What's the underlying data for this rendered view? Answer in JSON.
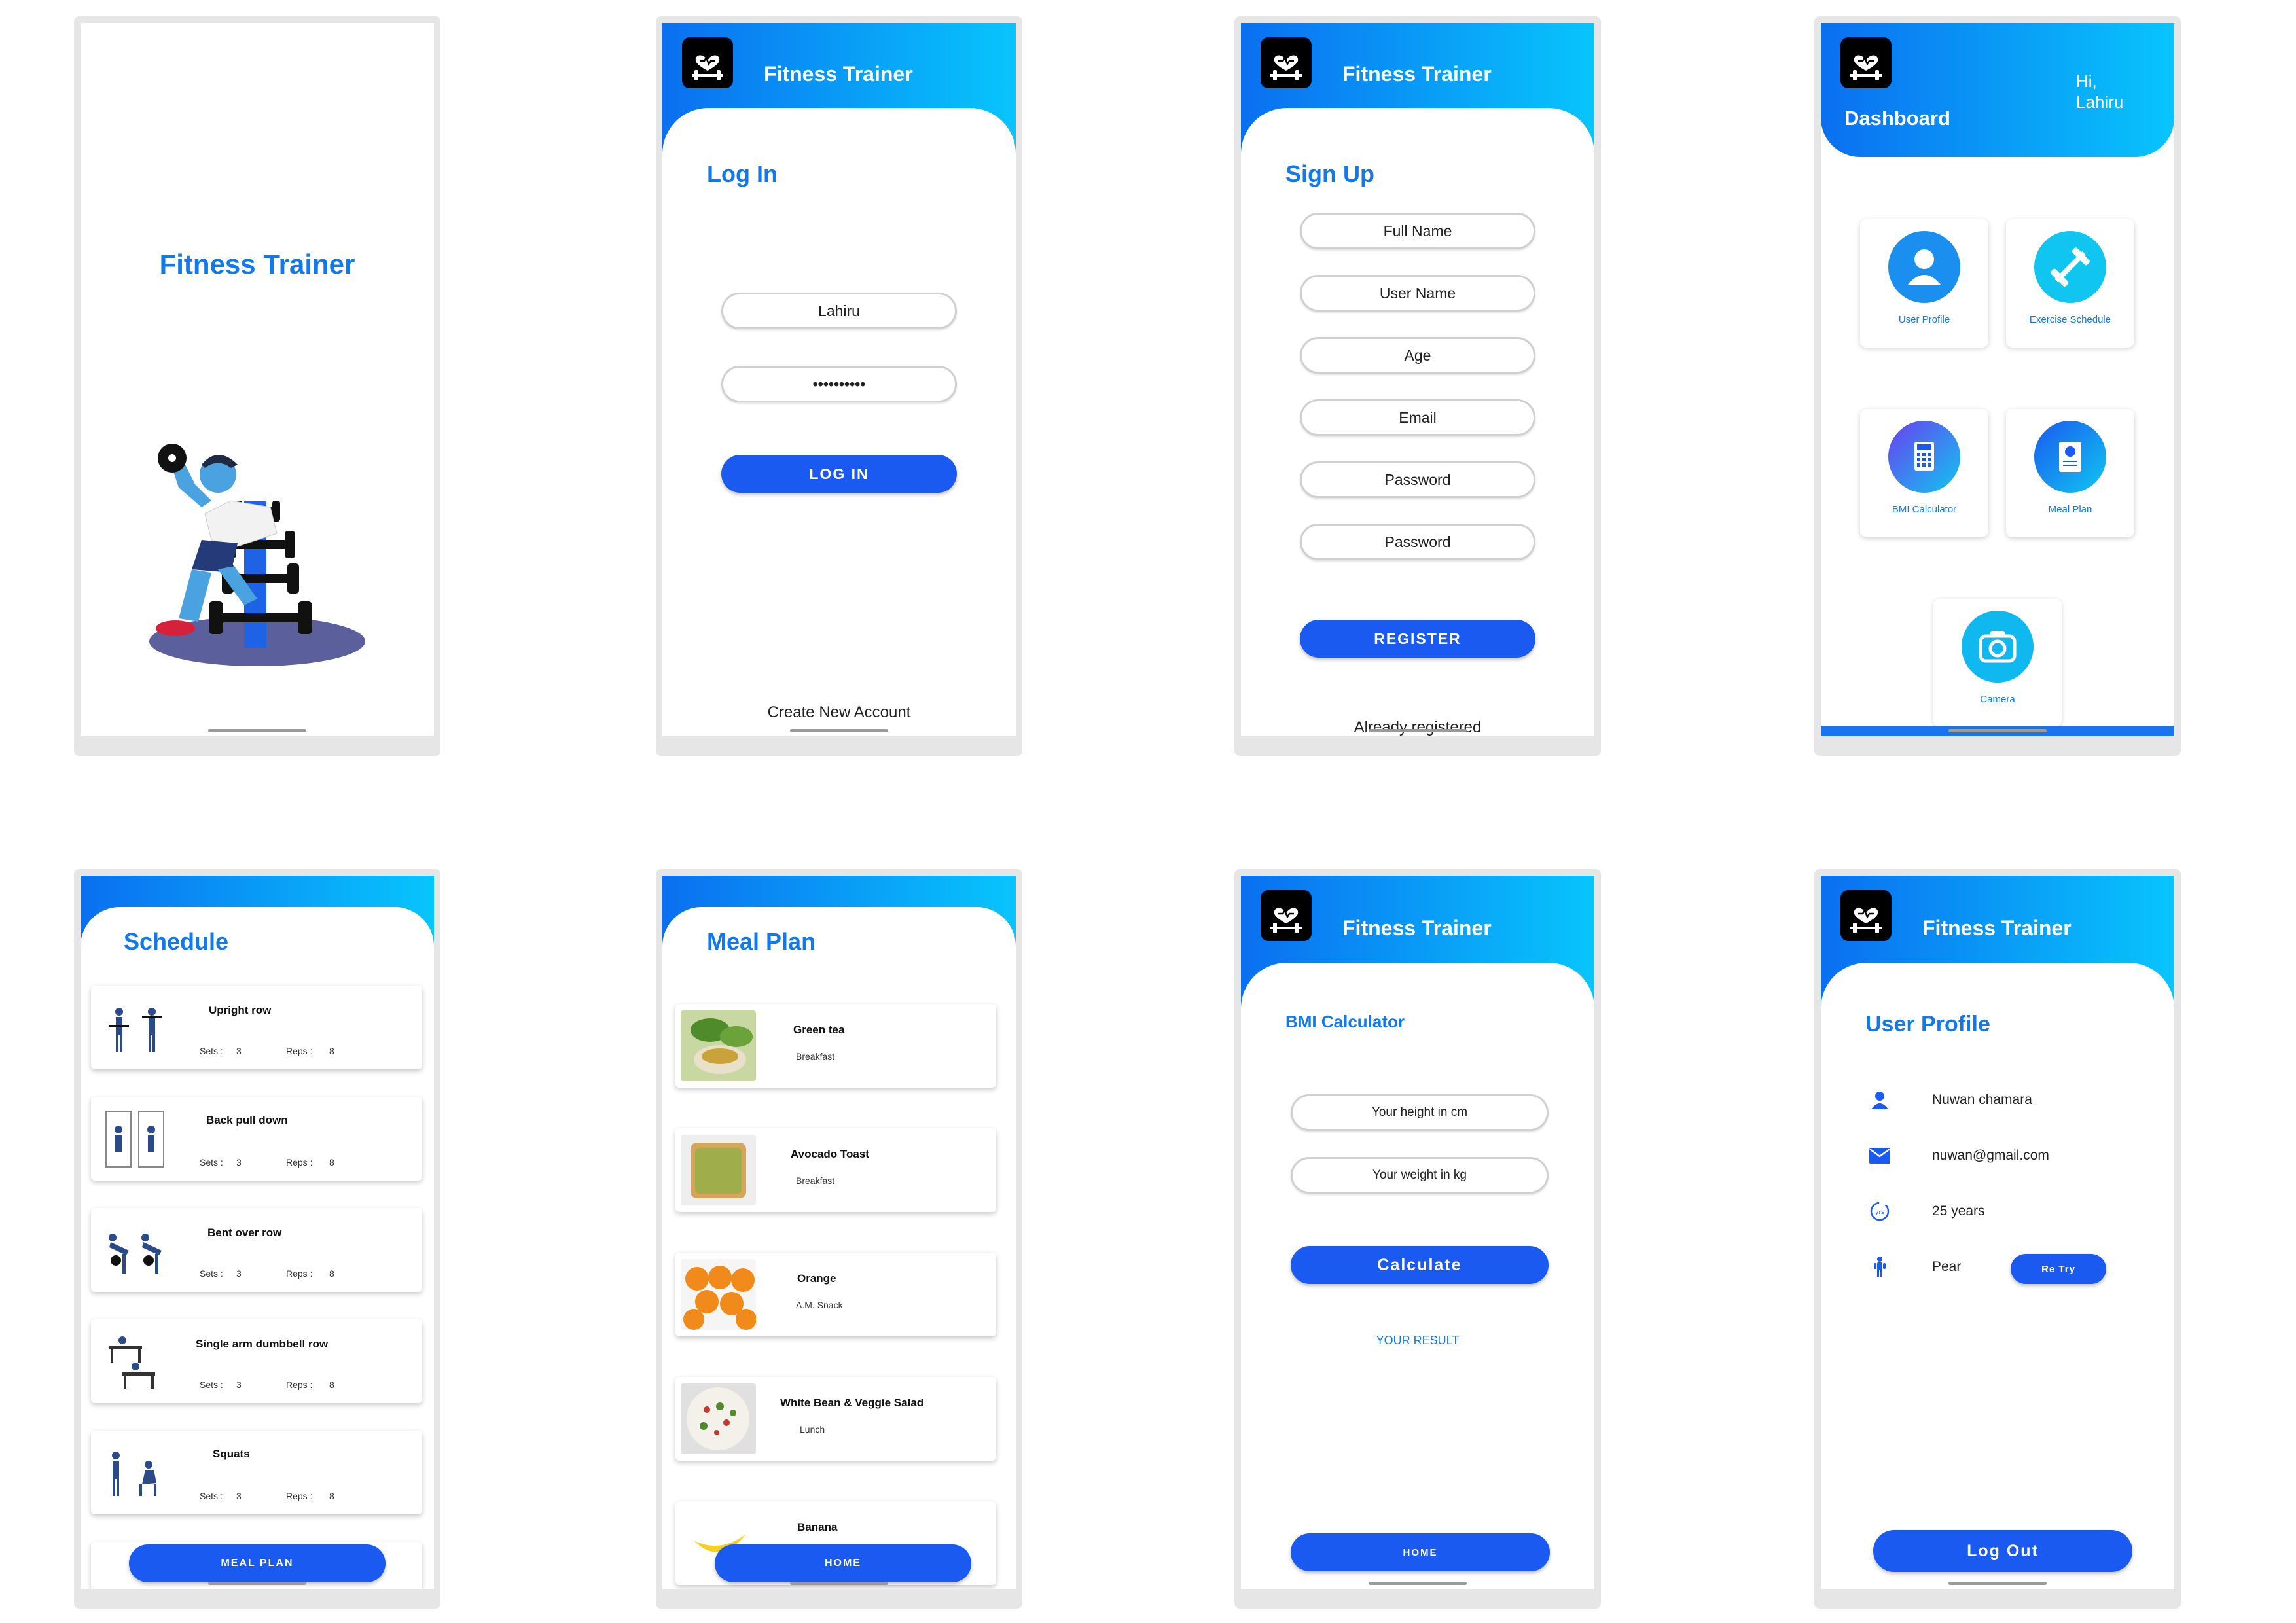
{
  "app_title": "Fitness Trainer",
  "splash": {
    "title": "Fitness Trainer"
  },
  "login": {
    "header_title": "Fitness Trainer",
    "page_title": "Log In",
    "username_value": "Lahiru",
    "password_value": "••••••••••",
    "login_button": "LOG IN",
    "create_account_link": "Create New Account"
  },
  "signup": {
    "header_title": "Fitness Trainer",
    "page_title": "Sign Up",
    "fields": [
      "Full Name",
      "User Name",
      "Age",
      "Email",
      "Password",
      "Password"
    ],
    "register_button": "REGISTER",
    "already_registered_link": "Already registered"
  },
  "dashboard": {
    "title": "Dashboard",
    "greeting_hi": "Hi,",
    "greeting_name": "Lahiru",
    "tiles": [
      {
        "label": "User Profile",
        "icon": "user-icon"
      },
      {
        "label": "Exercise Schedule",
        "icon": "dumbbell-icon"
      },
      {
        "label": "BMI Calculator",
        "icon": "calculator-icon"
      },
      {
        "label": "Meal Plan",
        "icon": "clipboard-icon"
      },
      {
        "label": "Camera",
        "icon": "camera-icon"
      }
    ]
  },
  "schedule": {
    "page_title": "Schedule",
    "sets_label": "Sets :",
    "reps_label": "Reps :",
    "items": [
      {
        "name": "Upright row",
        "sets": "3",
        "reps": "8"
      },
      {
        "name": "Back pull down",
        "sets": "3",
        "reps": "8"
      },
      {
        "name": "Bent over row",
        "sets": "3",
        "reps": "8"
      },
      {
        "name": "Single arm dumbbell row",
        "sets": "3",
        "reps": "8"
      },
      {
        "name": "Squats",
        "sets": "3",
        "reps": "8"
      }
    ],
    "nav_button": "MEAL PLAN"
  },
  "meal_plan": {
    "page_title": "Meal Plan",
    "items": [
      {
        "name": "Green tea",
        "meal": "Breakfast"
      },
      {
        "name": "Avocado Toast",
        "meal": "Breakfast"
      },
      {
        "name": "Orange",
        "meal": "A.M. Snack"
      },
      {
        "name": "White Bean & Veggie Salad",
        "meal": "Lunch"
      },
      {
        "name": "Banana",
        "meal": ""
      }
    ],
    "nav_button": "HOME"
  },
  "bmi": {
    "header_title": "Fitness Trainer",
    "page_title": "BMI Calculator",
    "height_placeholder": "Your height in cm",
    "weight_placeholder": "Your weight in kg",
    "calculate_button": "Calculate",
    "result_label": "YOUR RESULT",
    "home_button": "HOME"
  },
  "profile": {
    "header_title": "Fitness Trainer",
    "page_title": "User Profile",
    "name": "Nuwan chamara",
    "email": "nuwan@gmail.com",
    "age": "25 years",
    "body_type": "Pear",
    "retry_button": "Re Try",
    "logout_button": "Log Out"
  },
  "colors": {
    "primary_blue": "#1a5af0",
    "title_blue": "#1479e8",
    "gradient_start": "#0a6ff0",
    "gradient_end": "#08c5fc"
  }
}
